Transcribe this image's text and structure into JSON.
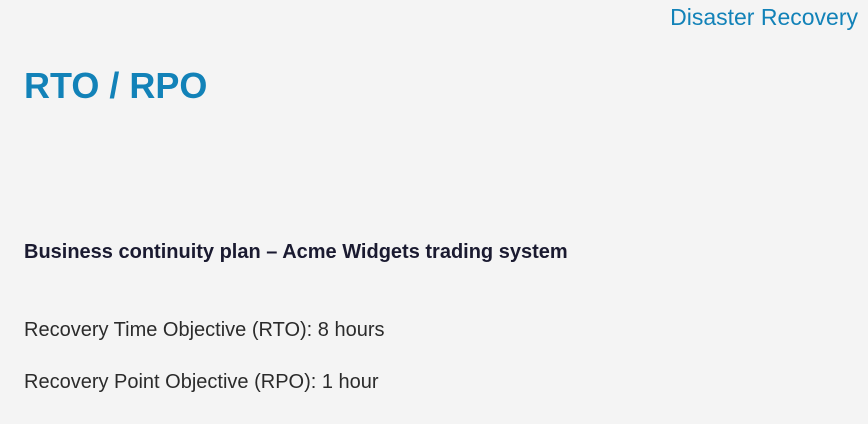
{
  "header": {
    "section_label": "Disaster Recovery"
  },
  "slide": {
    "title": "RTO / RPO",
    "subheading": "Business continuity plan – Acme Widgets trading system",
    "objectives": [
      "Recovery Time Objective (RTO): 8 hours",
      "Recovery Point Objective (RPO): 1 hour"
    ]
  },
  "colors": {
    "accent": "#1282b8",
    "heading_text": "#1a1a30",
    "body_text": "#2b2b2b",
    "background": "#f4f4f4"
  }
}
